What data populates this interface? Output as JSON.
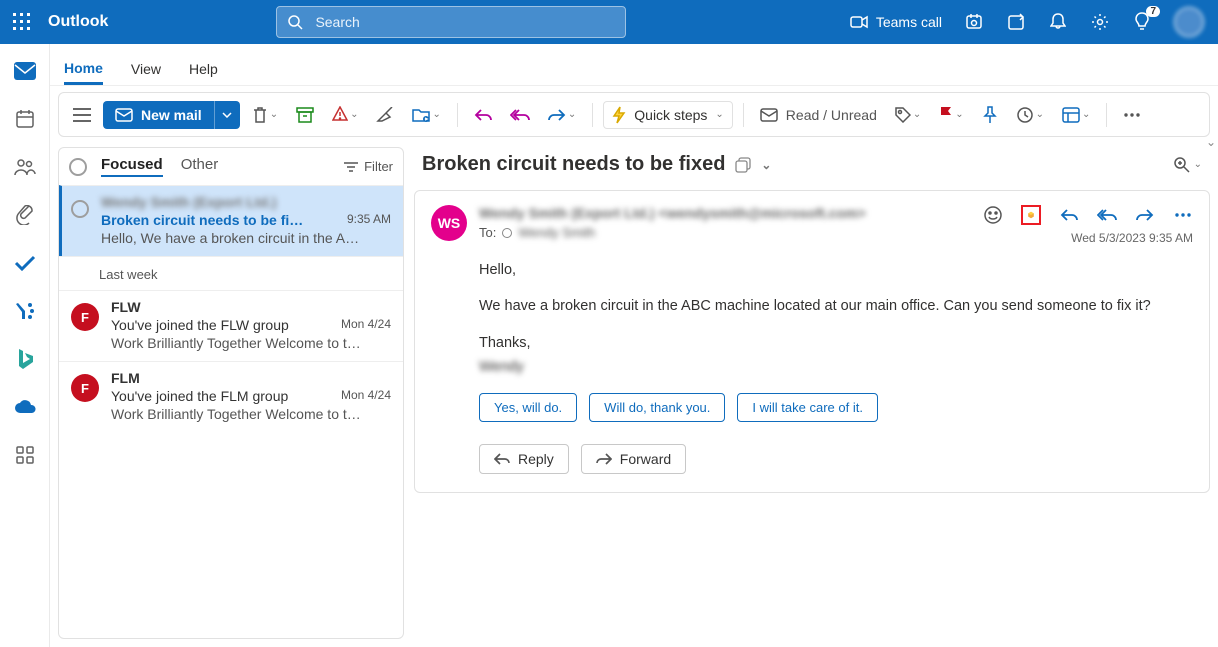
{
  "brand": "Outlook",
  "search": {
    "placeholder": "Search"
  },
  "top": {
    "teams_call": "Teams call",
    "tips_badge": "7"
  },
  "tabs": {
    "home": "Home",
    "view": "View",
    "help": "Help"
  },
  "ribbon": {
    "new_mail": "New mail",
    "quick_steps": "Quick steps",
    "read_unread": "Read / Unread"
  },
  "mlist": {
    "focused": "Focused",
    "other": "Other",
    "filter": "Filter",
    "group_last_week": "Last week"
  },
  "messages": [
    {
      "sender": "Wendy Smith (Export Ltd.)",
      "sender_blur": true,
      "subject": "Broken circuit needs to be fi…",
      "time": "9:35 AM",
      "preview": "Hello, We have a broken circuit in the A…",
      "selected": true,
      "avatar": null
    },
    {
      "sender": "FLW",
      "subject": "You've joined the FLW group",
      "time": "Mon 4/24",
      "preview": "Work Brilliantly Together Welcome to t…",
      "avatar": "F",
      "avcolor": "#c50f1f"
    },
    {
      "sender": "FLM",
      "subject": "You've joined the FLM group",
      "time": "Mon 4/24",
      "preview": "Work Brilliantly Together Welcome to t…",
      "avatar": "F",
      "avcolor": "#c50f1f"
    }
  ],
  "reading": {
    "title": "Broken circuit needs to be fixed",
    "from": "Wendy Smith (Export Ltd.) <wendysmith@microsoft.com>",
    "avatar_initials": "WS",
    "to_label": "To:",
    "to_value": "Wendy Smith",
    "timestamp": "Wed 5/3/2023 9:35 AM",
    "body_hello": "Hello,",
    "body_main": "We have a broken circuit in the ABC machine located at   our main office. Can you send someone to fix it?",
    "body_thanks": "Thanks,",
    "body_signature": "Wendy",
    "suggest1": "Yes, will do.",
    "suggest2": "Will do, thank you.",
    "suggest3": "I will take care of it.",
    "reply": "Reply",
    "forward": "Forward"
  }
}
